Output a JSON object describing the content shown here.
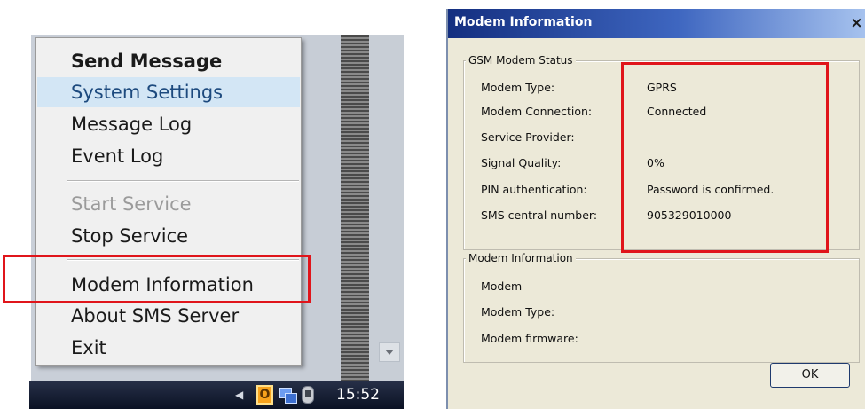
{
  "context_menu": {
    "items": [
      {
        "label": "Send Message",
        "style": "bold"
      },
      {
        "label": "System Settings",
        "style": "highlighted"
      },
      {
        "label": "Message Log",
        "style": "normal"
      },
      {
        "label": "Event Log",
        "style": "normal"
      },
      {
        "label": "Start Service",
        "style": "disabled"
      },
      {
        "label": "Stop Service",
        "style": "normal"
      },
      {
        "label": "Modem Information",
        "style": "normal"
      },
      {
        "label": "About SMS Server",
        "style": "normal"
      },
      {
        "label": "Exit",
        "style": "normal"
      }
    ]
  },
  "taskbar": {
    "clock": "15:52",
    "icons": [
      "office-tray-icon",
      "network-tray-icon",
      "phone-tray-icon"
    ],
    "office_glyph": "O"
  },
  "dialog": {
    "title": "Modem Information",
    "close_glyph": "×",
    "gsm_status": {
      "legend": "GSM Modem Status",
      "rows": [
        {
          "label": "Modem Type:",
          "value": "GPRS"
        },
        {
          "label": "Modem Connection:",
          "value": "Connected"
        },
        {
          "label": "Service Provider:",
          "value": ""
        },
        {
          "label": "Signal Quality:",
          "value": "0%"
        },
        {
          "label": "PIN authentication:",
          "value": "Password is confirmed."
        },
        {
          "label": "SMS central number:",
          "value": "905329010000"
        }
      ]
    },
    "modem_info": {
      "legend": "Modem Information",
      "rows": [
        {
          "label": "Modem",
          "value": ""
        },
        {
          "label": "Modem Type:",
          "value": ""
        },
        {
          "label": "Modem firmware:",
          "value": ""
        }
      ]
    },
    "ok_label": "OK"
  },
  "colors": {
    "highlight_box": "#e0151b",
    "menu_hover_bg": "#d3e6f5",
    "titlebar_start": "#142f80",
    "dialog_bg": "#ece9d8"
  }
}
